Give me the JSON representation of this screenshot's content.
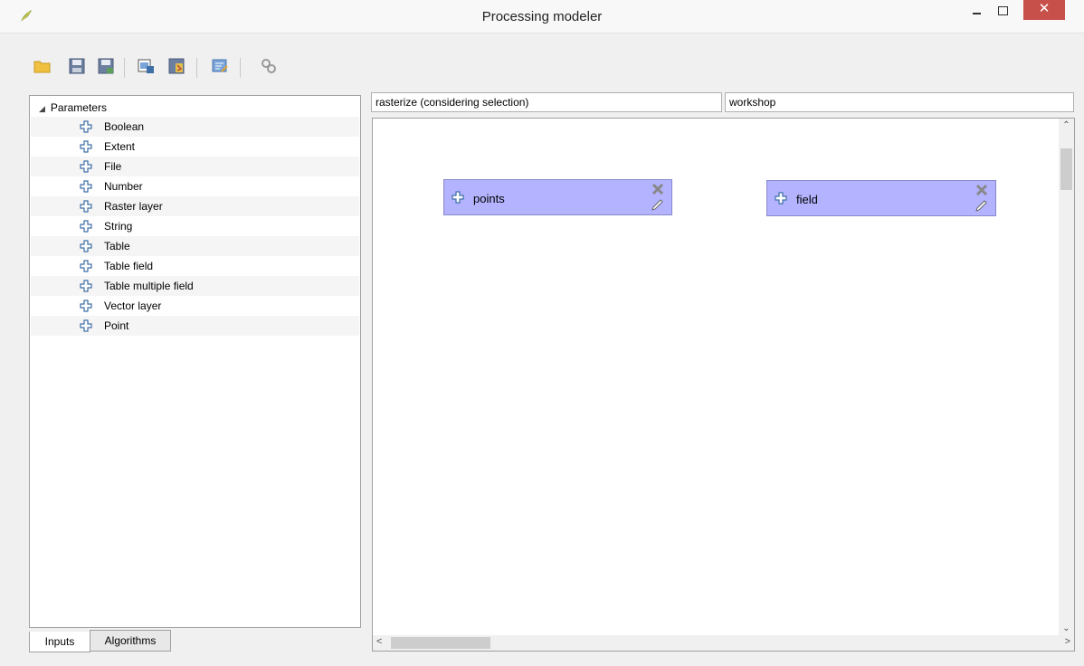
{
  "window": {
    "title": "Processing modeler",
    "close_glyph": "✕"
  },
  "toolbar": {
    "buttons": [
      {
        "icon": "open-folder-icon"
      },
      {
        "icon": "save-icon"
      },
      {
        "icon": "save-as-icon"
      },
      {
        "icon": "export-image-icon"
      },
      {
        "icon": "export-python-icon"
      },
      {
        "icon": "edit-help-icon"
      },
      {
        "icon": "run-model-icon"
      }
    ]
  },
  "tree": {
    "root_label": "Parameters",
    "items": [
      "Boolean",
      "Extent",
      "File",
      "Number",
      "Raster layer",
      "String",
      "Table",
      "Table field",
      "Table multiple field",
      "Vector layer",
      "Point"
    ]
  },
  "tabs": {
    "inputs": "Inputs",
    "algorithms": "Algorithms"
  },
  "model": {
    "name": "rasterize (considering selection)",
    "group": "workshop"
  },
  "canvas": {
    "nodes": [
      {
        "label": "points"
      },
      {
        "label": "field"
      }
    ]
  },
  "colors": {
    "node_fill": "#b3b3ff",
    "close_button": "#c7504a"
  }
}
